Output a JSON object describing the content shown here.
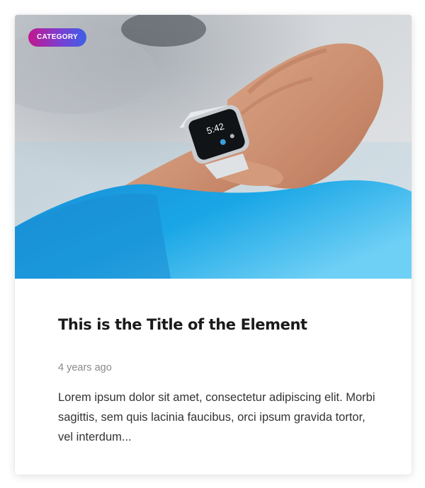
{
  "card": {
    "category": "CATEGORY",
    "title": "This is the Title of the Element",
    "date": "4 years ago",
    "excerpt": "Lorem ipsum dolor sit amet, consectetur adipiscing elit. Morbi sagittis, sem quis lacinia faucibus, orci ipsum gravida tortor, vel interdum..."
  },
  "colors": {
    "badge_gradient_start": "#c2178e",
    "badge_gradient_end": "#3d5fe8",
    "sleeve_blue": "#1aa7e6",
    "title_text": "#1a1a1a",
    "date_text": "#8a8a8a",
    "body_text": "#333333"
  },
  "image": {
    "subject": "wrist-smartwatch-photo"
  }
}
